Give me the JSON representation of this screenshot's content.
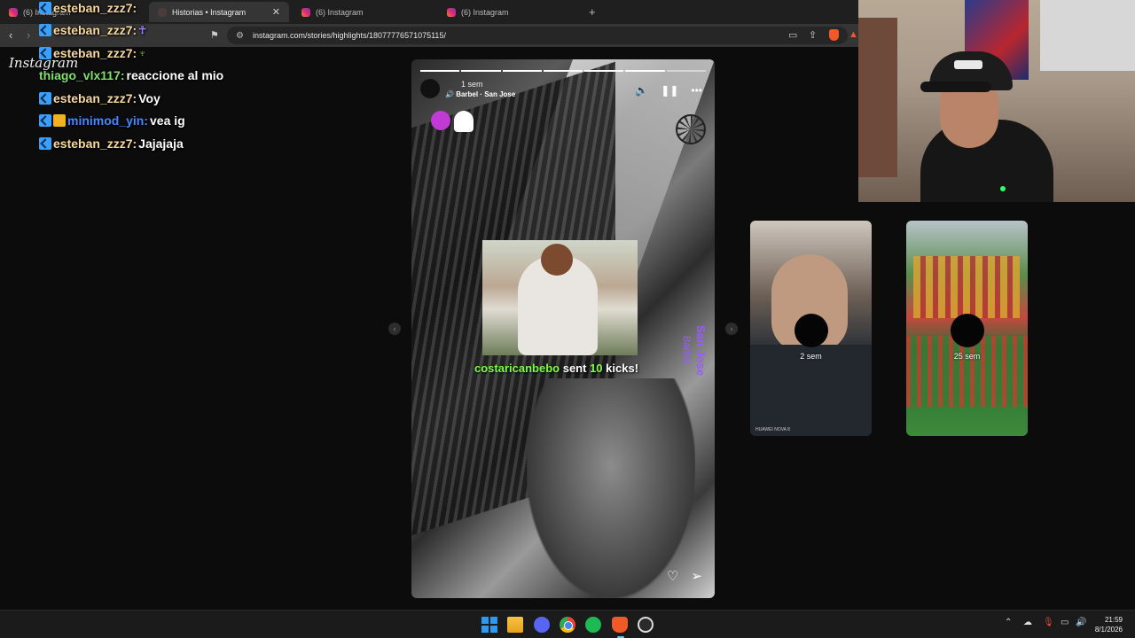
{
  "browser": {
    "tabs": [
      {
        "label": "(6) Instagram",
        "active": false
      },
      {
        "label": "Historias • Instagram",
        "active": true
      },
      {
        "label": "(6) Instagram",
        "active": false
      },
      {
        "label": "(6) Instagram",
        "active": false
      }
    ],
    "new_tab": "+",
    "url": "instagram.com/stories/highlights/18077776571075115/"
  },
  "page": {
    "logo": "Instagram"
  },
  "chat": {
    "messages": [
      {
        "user": "esteban_zzz7:",
        "text": "",
        "color": "#f6d99b"
      },
      {
        "user": "esteban_zzz7:",
        "text": "",
        "color": "#f6d99b"
      },
      {
        "user": "esteban_zzz7:",
        "text": "",
        "color": "#f6d99b"
      },
      {
        "user": "thiago_vlx117:",
        "text": "reaccione al mio",
        "color": "#7fe06a"
      },
      {
        "user": "esteban_zzz7:",
        "text": "Voy",
        "color": "#f6d99b"
      },
      {
        "user": "minimod_yin:",
        "text": "vea ig",
        "color": "#3f8bff"
      },
      {
        "user": "esteban_zzz7:",
        "text": "Jajajaja",
        "color": "#f6d99b"
      }
    ]
  },
  "story": {
    "time": "1 sem",
    "audio": "Barbel · San Jose",
    "sticker_location": "San Jose",
    "sticker_name": "Barbel",
    "progress_segments": 7,
    "progress_done": 6
  },
  "overlay": {
    "kicks_user": "costaricanbebo",
    "kicks_sent": "sent",
    "kicks_count": "10",
    "kicks_word": "kicks!"
  },
  "previews": [
    {
      "time": "2 sem",
      "watermark": "HUAWEI NOVA 8"
    },
    {
      "time": "25 sem",
      "watermark": ""
    }
  ],
  "taskbar": {
    "time": "21:59",
    "date": "8/1/2026"
  }
}
